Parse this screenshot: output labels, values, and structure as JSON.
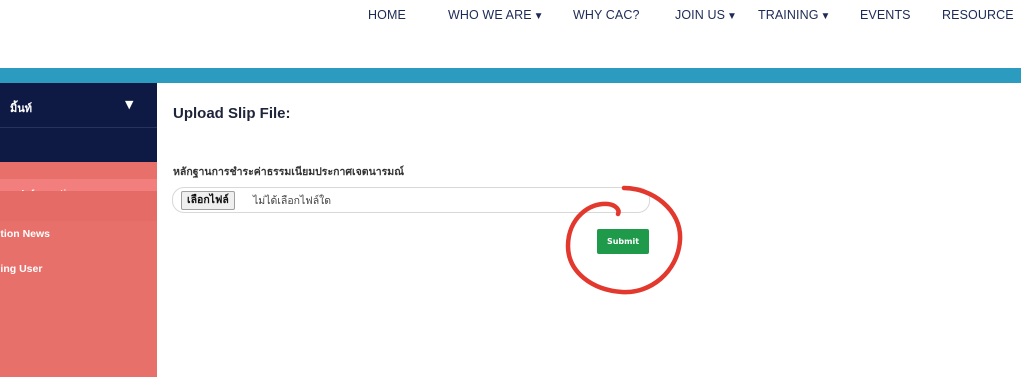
{
  "nav": {
    "items": [
      {
        "label": "HOME",
        "caret": ""
      },
      {
        "label": "WHO WE ARE",
        "caret": "▼"
      },
      {
        "label": "WHY CAC?",
        "caret": ""
      },
      {
        "label": "JOIN US",
        "caret": "▼"
      },
      {
        "label": "TRAINING",
        "caret": "▼"
      },
      {
        "label": "EVENTS",
        "caret": ""
      },
      {
        "label": "RESOURCE",
        "caret": ""
      }
    ]
  },
  "sidebar": {
    "user_name": "มิ้นท์",
    "user_caret": "▼",
    "items": [
      {
        "label": "pany Information"
      },
      {
        "label": "ption News"
      },
      {
        "label": "ning User"
      }
    ]
  },
  "main": {
    "title": "Upload Slip File:",
    "field_label": "หลักฐานการชำระค่าธรรมเนียมประกาศเจตนารมณ์",
    "file_button": "เลือกไฟล์",
    "file_status": "ไม่ได้เลือกไฟล์ใด",
    "submit_label": "Submit"
  },
  "colors": {
    "nav_text": "#1d2a57",
    "blue_bar": "#2c9bc0",
    "sidebar_dark": "#0e1a44",
    "sidebar_bg": "#e8706b",
    "sidebar_active": "#f37e7e",
    "submit_bg": "#1f9a4b",
    "annotation_circle": "#e2382d"
  }
}
